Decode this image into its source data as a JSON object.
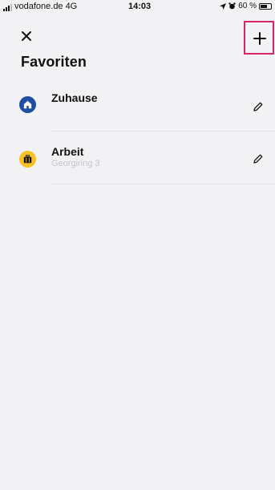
{
  "status_bar": {
    "carrier": "vodafone.de",
    "network": "4G",
    "time": "14:03",
    "battery": "60 %",
    "battery_level": 0.6
  },
  "header": {
    "close_icon": "close-icon",
    "add_icon": "plus-icon",
    "title": "Favoriten"
  },
  "favorites": [
    {
      "name": "Zuhause",
      "address": "",
      "icon": "home-icon",
      "icon_color": "#1e4fa3"
    },
    {
      "name": "Arbeit",
      "address": "Georgiring 3",
      "icon": "briefcase-icon",
      "icon_color": "#f7c123"
    }
  ],
  "colors": {
    "highlight": "#d6246e",
    "background": "#f2f2f4"
  }
}
